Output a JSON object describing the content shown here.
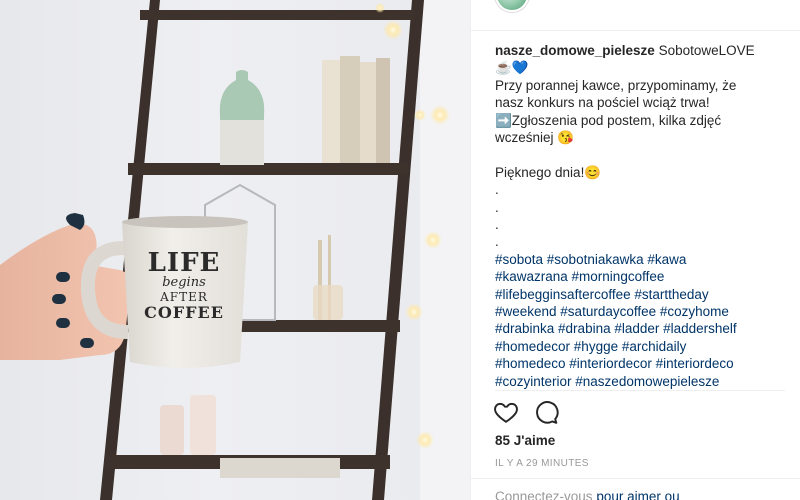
{
  "post": {
    "username": "nasze_domowe_pielesze",
    "title_text": "SobotoweLOVE",
    "title_emoji": "☕💙",
    "body_lines": [
      "Przy porannej kawce, przypominamy, że",
      "nasz konkurs na pościel wciąż trwa!",
      "➡️Zgłoszenia pod postem, kilka zdjęć",
      "wcześniej 😘"
    ],
    "greeting": "Pięknego dnia!😊",
    "dots": [
      ".",
      ".",
      ".",
      "."
    ],
    "hashtag_lines": [
      "#sobota #sobotniakawka #kawa",
      "#kawazrana #morningcoffee",
      "#lifebegginsaftercoffee #starttheday",
      "#weekend #saturdaycoffee #cozyhome",
      "#drabinka #drabina #ladder #laddershelf",
      "#homedecor #hygge #archidaily",
      "#homedeco #interiordecor #interiordeco",
      "#cozyinterior #naszedomowepielesze"
    ]
  },
  "actions": {
    "like_icon": "heart-icon",
    "comment_icon": "comment-icon"
  },
  "likes_text": "85 J'aime",
  "timestamp": "IL Y A 29 MINUTES",
  "login_prompt": {
    "prefix": "Connectez-vous ",
    "link": "pour aimer ou"
  },
  "mug": {
    "line1": "LIFE",
    "line2": "begins",
    "line3": "AFTER",
    "line4": "COFFEE"
  },
  "colors": {
    "link": "#003569",
    "muted": "#999999",
    "shelf_wood": "#3b302b",
    "nail_polish": "#1f3140"
  }
}
